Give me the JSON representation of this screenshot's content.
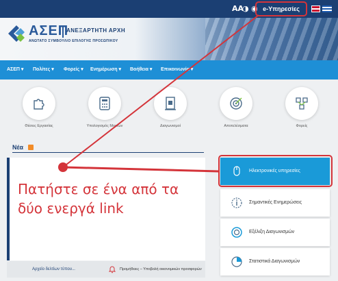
{
  "topbar": {
    "font_control": "AΑ",
    "eservices_label": "e-Υπηρεσίες",
    "icons": [
      "contrast-icon",
      "visibility-icon"
    ],
    "flags": [
      "uk-flag-icon",
      "greek-flag-icon"
    ]
  },
  "header": {
    "logo_main": "ΑΣΕΠ",
    "logo_sub1": "ΑΝΕΞΑΡΤΗΤΗ ΑΡΧΗ",
    "logo_sub2": "ΑΝΩΤΑΤΟ ΣΥΜΒΟΥΛΙΟ ΕΠΙΛΟΓΗΣ ΠΡΟΣΩΠΙΚΟΥ"
  },
  "nav": {
    "items": [
      {
        "label": "ΑΣΕΠ ▾"
      },
      {
        "label": "Πολίτες ▾"
      },
      {
        "label": "Φορείς ▾"
      },
      {
        "label": "Ενημέρωση ▾"
      },
      {
        "label": "Βοήθεια ▾"
      },
      {
        "label": "Επικοινωνία ▾"
      }
    ]
  },
  "icons": [
    {
      "label": "Θέσεις Εργασίας",
      "icon": "puzzle-icon"
    },
    {
      "label": "Υπολογισμός Μορίων",
      "icon": "calculator-icon"
    },
    {
      "label": "Διαγωνισμοί",
      "icon": "document-icon"
    },
    {
      "label": "Αποτελέσματα",
      "icon": "target-icon"
    },
    {
      "label": "Φορείς",
      "icon": "network-icon"
    }
  ],
  "news": {
    "title": "Νέα",
    "tab1": "Αρχείο δελτίων τύπου...",
    "tab2": "Προμήθειες – Υποβολή οικονομικών προσφορών"
  },
  "cards": [
    {
      "label": "Ηλεκτρονικές υπηρεσίες",
      "icon": "mouse-icon"
    },
    {
      "label": "Σημαντικές Ενημερώσεις",
      "icon": "info-icon"
    },
    {
      "label": "Εξέλιξη Διαγωνισμών",
      "icon": "progress-icon"
    },
    {
      "label": "Στατιστικά Διαγωνισμών",
      "icon": "pie-chart-icon"
    }
  ],
  "annotation": {
    "line1": "Πατήστε σε ένα από τα",
    "line2": "δύο ενεργά link"
  },
  "colors": {
    "topbar": "#1b3f73",
    "nav": "#1e8fd6",
    "active_card": "#1a9ad8",
    "annotation": "#d4343a"
  }
}
